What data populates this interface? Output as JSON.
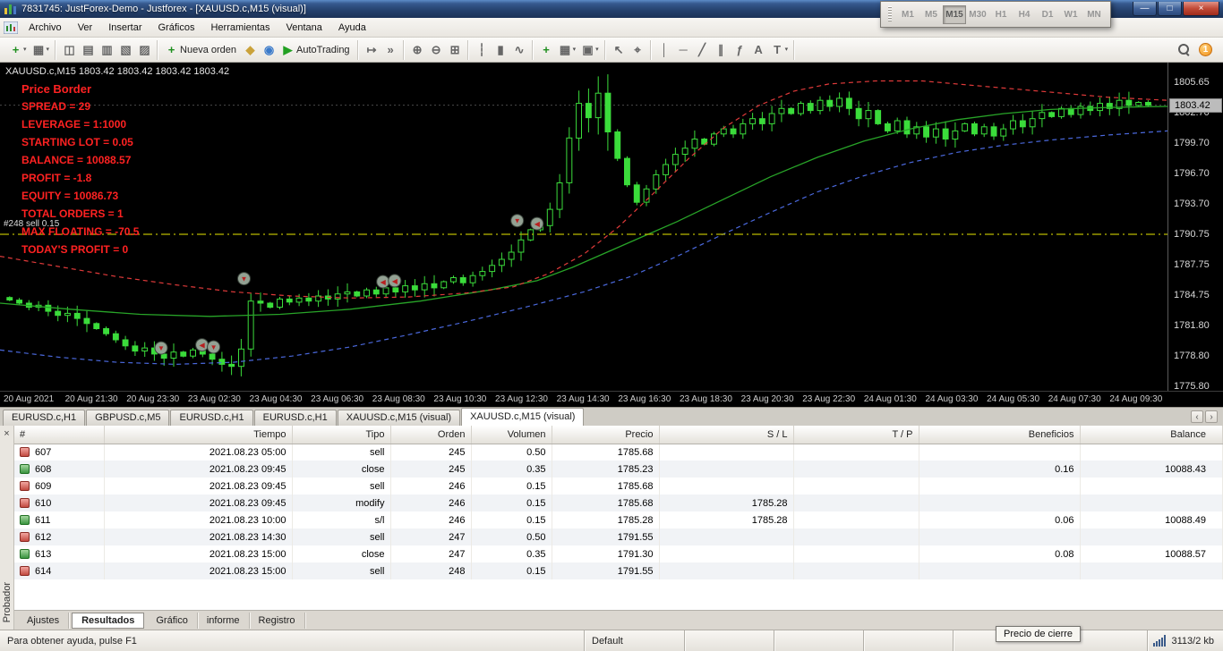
{
  "window": {
    "title": "7831745: JustForex-Demo - Justforex - [XAUUSD.c,M15 (visual)]",
    "buttons": {
      "minimize": "—",
      "restore": "□",
      "close": "×"
    }
  },
  "menu": {
    "items": [
      "Archivo",
      "Ver",
      "Insertar",
      "Gráficos",
      "Herramientas",
      "Ventana",
      "Ayuda"
    ]
  },
  "toolbar": {
    "groups": [
      {
        "items": [
          {
            "name": "new-chart",
            "glyph": "+",
            "color": "#1f8f1f",
            "dropdown": true
          },
          {
            "name": "profiles",
            "glyph": "▦",
            "color": "#666666",
            "dropdown": true
          }
        ]
      },
      {
        "items": [
          {
            "name": "market-watch",
            "glyph": "◫",
            "color": "#666666"
          },
          {
            "name": "data-window",
            "glyph": "▤",
            "color": "#666666"
          },
          {
            "name": "navigator",
            "glyph": "▥",
            "color": "#666666"
          },
          {
            "name": "terminal",
            "glyph": "▧",
            "color": "#666666"
          },
          {
            "name": "strategy-tester",
            "glyph": "▨",
            "color": "#666666"
          }
        ]
      },
      {
        "items": [
          {
            "name": "new-order",
            "glyph": "+",
            "color": "#1f8f1f",
            "label": "Nueva orden"
          },
          {
            "name": "metaeditor",
            "glyph": "◆",
            "color": "#caa23a"
          },
          {
            "name": "signals",
            "glyph": "◉",
            "color": "#3a7aca"
          },
          {
            "name": "autotrading",
            "glyph": "▶",
            "color": "#22a022",
            "label": "AutoTrading"
          }
        ]
      },
      {
        "items": [
          {
            "name": "chart-shift",
            "glyph": "↦",
            "color": "#666666"
          },
          {
            "name": "auto-scroll",
            "glyph": "»",
            "color": "#666666"
          }
        ]
      },
      {
        "items": [
          {
            "name": "zoom-in",
            "glyph": "⊕",
            "color": "#666666"
          },
          {
            "name": "zoom-out",
            "glyph": "⊖",
            "color": "#666666"
          },
          {
            "name": "tile-windows",
            "glyph": "⊞",
            "color": "#666666"
          }
        ]
      },
      {
        "items": [
          {
            "name": "bar-chart-mode",
            "glyph": "┆",
            "color": "#666666"
          },
          {
            "name": "candlestick-mode",
            "glyph": "▮",
            "color": "#666666"
          },
          {
            "name": "line-chart-mode",
            "glyph": "∿",
            "color": "#666666"
          }
        ]
      },
      {
        "items": [
          {
            "name": "indicators",
            "glyph": "+",
            "color": "#1f8f1f"
          },
          {
            "name": "periods",
            "glyph": "▦",
            "color": "#666666",
            "dropdown": true
          },
          {
            "name": "templates",
            "glyph": "▣",
            "color": "#666666",
            "dropdown": true
          }
        ]
      },
      {
        "items": [
          {
            "name": "cursor",
            "glyph": "↖",
            "color": "#666666"
          },
          {
            "name": "crosshair",
            "glyph": "⌖",
            "color": "#666666"
          }
        ]
      },
      {
        "items": [
          {
            "name": "vertical-line",
            "glyph": "│",
            "color": "#666666"
          },
          {
            "name": "horizontal-line",
            "glyph": "─",
            "color": "#666666"
          },
          {
            "name": "trendline",
            "glyph": "╱",
            "color": "#666666"
          },
          {
            "name": "channel",
            "glyph": "∥",
            "color": "#666666"
          },
          {
            "name": "fibonacci",
            "glyph": "ƒ",
            "color": "#666666"
          },
          {
            "name": "text-tool",
            "glyph": "A",
            "color": "#666666"
          },
          {
            "name": "arrow-tools",
            "glyph": "T",
            "color": "#666666",
            "dropdown": true
          }
        ]
      }
    ],
    "notification_count": "1"
  },
  "timeframes": {
    "buttons": [
      "M1",
      "M5",
      "M15",
      "M30",
      "H1",
      "H4",
      "D1",
      "W1",
      "MN"
    ],
    "active": "M15"
  },
  "chart": {
    "symbol_info": "XAUUSD.c,M15  1803.42 1803.42 1803.42 1803.42",
    "ea_lines": [
      "Price Border",
      "SPREAD = 29",
      "LEVERAGE = 1:1000",
      "STARTING LOT = 0.05",
      "BALANCE = 10088.57",
      "PROFIT = -1.8",
      "EQUITY =  10086.73",
      "TOTAL ORDERS = 1",
      "MAX FLOATING = -70.5",
      "TODAY'S PROFIT = 0"
    ],
    "position_label": "#248 sell 0.15",
    "current_price_label": "1803.42",
    "time_labels": [
      "20 Aug 2021",
      "20 Aug 21:30",
      "20 Aug 23:30",
      "23 Aug 02:30",
      "23 Aug 04:30",
      "23 Aug 06:30",
      "23 Aug 08:30",
      "23 Aug 10:30",
      "23 Aug 12:30",
      "23 Aug 14:30",
      "23 Aug 16:30",
      "23 Aug 18:30",
      "23 Aug 20:30",
      "23 Aug 22:30",
      "24 Aug 01:30",
      "24 Aug 03:30",
      "24 Aug 05:30",
      "24 Aug 07:30",
      "24 Aug 09:30"
    ]
  },
  "chart_data": {
    "type": "candlestick",
    "symbol": "XAUUSD.c",
    "timeframe": "M15",
    "price_top": 1807.6,
    "price_bottom": 1775.4,
    "current_price": 1803.42,
    "position_line": 1790.75,
    "price_ticks": [
      1805.65,
      1802.7,
      1799.7,
      1796.7,
      1793.7,
      1790.75,
      1787.75,
      1784.75,
      1781.8,
      1778.8,
      1775.8
    ],
    "closes": [
      1784.3,
      1784.0,
      1783.6,
      1783.8,
      1783.2,
      1782.8,
      1783.0,
      1782.5,
      1782.0,
      1781.5,
      1781.0,
      1780.4,
      1779.8,
      1779.3,
      1779.6,
      1779.0,
      1778.6,
      1779.2,
      1778.8,
      1779.4,
      1779.0,
      1778.5,
      1778.0,
      1777.8,
      1779.5,
      1784.2,
      1784.0,
      1783.6,
      1784.4,
      1784.1,
      1784.5,
      1784.2,
      1784.7,
      1784.4,
      1784.9,
      1785.1,
      1784.7,
      1785.3,
      1784.9,
      1785.5,
      1785.1,
      1785.7,
      1785.3,
      1785.9,
      1785.5,
      1786.1,
      1786.5,
      1786.0,
      1786.7,
      1787.1,
      1787.7,
      1788.3,
      1789.0,
      1790.2,
      1791.2,
      1791.6,
      1793.2,
      1795.8,
      1800.2,
      1803.6,
      1802.2,
      1804.6,
      1800.8,
      1798.2,
      1795.6,
      1793.9,
      1795.2,
      1796.6,
      1797.6,
      1798.6,
      1799.2,
      1800.1,
      1799.6,
      1800.6,
      1801.1,
      1800.6,
      1801.6,
      1802.1,
      1801.6,
      1802.6,
      1803.1,
      1802.6,
      1803.6,
      1802.9,
      1803.9,
      1803.3,
      1804.1,
      1803.1,
      1802.1,
      1802.9,
      1801.6,
      1800.9,
      1801.9,
      1800.6,
      1801.3,
      1800.3,
      1801.1,
      1800.1,
      1800.9,
      1801.6,
      1800.6,
      1801.3,
      1800.4,
      1801.1,
      1801.9,
      1801.3,
      1802.1,
      1802.7,
      1802.3,
      1803.1,
      1802.5,
      1803.3,
      1802.9,
      1803.6,
      1803.1,
      1803.9,
      1803.4,
      1803.7,
      1803.42
    ],
    "ma_green": [
      [
        0,
        1784.0
      ],
      [
        6,
        1783.4
      ],
      [
        12,
        1782.9
      ],
      [
        18,
        1782.7
      ],
      [
        24,
        1782.9
      ],
      [
        30,
        1783.4
      ],
      [
        36,
        1784.2
      ],
      [
        42,
        1785.3
      ],
      [
        46,
        1786.2
      ],
      [
        49,
        1787.5
      ],
      [
        52,
        1789.0
      ],
      [
        55,
        1790.5
      ],
      [
        58,
        1792.0
      ],
      [
        62,
        1794.2
      ],
      [
        66,
        1796.4
      ],
      [
        70,
        1798.3
      ],
      [
        74,
        1799.9
      ],
      [
        78,
        1801.1
      ],
      [
        82,
        1802.0
      ],
      [
        86,
        1802.6
      ],
      [
        90,
        1803.0
      ],
      [
        95,
        1803.2
      ],
      [
        100,
        1803.3
      ]
    ],
    "ma_red": [
      [
        0,
        1788.6
      ],
      [
        5,
        1787.6
      ],
      [
        10,
        1786.6
      ],
      [
        15,
        1785.8
      ],
      [
        20,
        1785.1
      ],
      [
        25,
        1784.7
      ],
      [
        30,
        1784.5
      ],
      [
        35,
        1784.6
      ],
      [
        40,
        1785.0
      ],
      [
        44,
        1785.6
      ],
      [
        47,
        1786.9
      ],
      [
        50,
        1788.8
      ],
      [
        53,
        1791.5
      ],
      [
        56,
        1794.8
      ],
      [
        59,
        1798.2
      ],
      [
        62,
        1801.2
      ],
      [
        65,
        1803.4
      ],
      [
        68,
        1804.8
      ],
      [
        71,
        1805.5
      ],
      [
        75,
        1805.8
      ],
      [
        79,
        1805.8
      ],
      [
        83,
        1805.4
      ],
      [
        87,
        1805.0
      ],
      [
        91,
        1804.6
      ],
      [
        95,
        1804.2
      ],
      [
        100,
        1803.9
      ]
    ],
    "ma_blue": [
      [
        0,
        1779.4
      ],
      [
        5,
        1778.7
      ],
      [
        10,
        1778.2
      ],
      [
        15,
        1778.0
      ],
      [
        20,
        1778.2
      ],
      [
        25,
        1778.8
      ],
      [
        30,
        1779.7
      ],
      [
        35,
        1780.9
      ],
      [
        40,
        1782.2
      ],
      [
        45,
        1783.6
      ],
      [
        50,
        1785.1
      ],
      [
        54,
        1786.6
      ],
      [
        58,
        1788.6
      ],
      [
        62,
        1790.8
      ],
      [
        66,
        1792.9
      ],
      [
        70,
        1794.9
      ],
      [
        74,
        1796.5
      ],
      [
        78,
        1797.8
      ],
      [
        82,
        1798.8
      ],
      [
        86,
        1799.5
      ],
      [
        90,
        1800.0
      ],
      [
        95,
        1800.5
      ],
      [
        100,
        1800.9
      ]
    ],
    "markers": [
      {
        "x": 13.8,
        "price": 1779.6,
        "glyph": "▼",
        "color": "#b82020"
      },
      {
        "x": 17.3,
        "price": 1779.9,
        "glyph": "◀",
        "color": "#b82020"
      },
      {
        "x": 18.3,
        "price": 1779.7,
        "glyph": "▼",
        "color": "#b82020"
      },
      {
        "x": 20.9,
        "price": 1786.4,
        "glyph": "▼",
        "color": "#b82020"
      },
      {
        "x": 32.8,
        "price": 1786.1,
        "glyph": "◀",
        "color": "#b82020"
      },
      {
        "x": 33.8,
        "price": 1786.2,
        "glyph": "◀",
        "color": "#b82020"
      },
      {
        "x": 44.3,
        "price": 1792.1,
        "glyph": "▼",
        "color": "#b82020"
      },
      {
        "x": 46.0,
        "price": 1791.8,
        "glyph": "◀",
        "color": "#b82020"
      }
    ],
    "colors": {
      "candle": "#3bdc3b",
      "ma_green": "#28a428",
      "ma_red": "#e03a3a",
      "ma_blue": "#4a68dc",
      "position_line": "#b9b900",
      "current_price_line": "#4a4a4a",
      "background": "#000000"
    }
  },
  "chart_tabs": {
    "tabs": [
      "EURUSD.c,H1",
      "GBPUSD.c,M5",
      "EURUSD.c,H1",
      "EURUSD.c,H1",
      "XAUUSD.c,M15 (visual)",
      "XAUUSD.c,M15 (visual)"
    ],
    "active_index": 5,
    "scroll_left": "‹",
    "scroll_right": "›"
  },
  "results": {
    "columns": [
      "#",
      "Tiempo",
      "Tipo",
      "Orden",
      "Volumen",
      "Precio",
      "S / L",
      "T / P",
      "Beneficios",
      "Balance"
    ],
    "rows": [
      {
        "icon": "sell",
        "cells": [
          "607",
          "2021.08.23 05:00",
          "sell",
          "245",
          "0.50",
          "1785.68",
          "",
          "",
          "",
          ""
        ]
      },
      {
        "icon": "close",
        "cells": [
          "608",
          "2021.08.23 09:45",
          "close",
          "245",
          "0.35",
          "1785.23",
          "",
          "",
          "0.16",
          "10088.43"
        ]
      },
      {
        "icon": "sell",
        "cells": [
          "609",
          "2021.08.23 09:45",
          "sell",
          "246",
          "0.15",
          "1785.68",
          "",
          "",
          "",
          ""
        ]
      },
      {
        "icon": "modify",
        "cells": [
          "610",
          "2021.08.23 09:45",
          "modify",
          "246",
          "0.15",
          "1785.68",
          "1785.28",
          "",
          "",
          ""
        ]
      },
      {
        "icon": "close",
        "cells": [
          "611",
          "2021.08.23 10:00",
          "s/l",
          "246",
          "0.15",
          "1785.28",
          "1785.28",
          "",
          "0.06",
          "10088.49"
        ]
      },
      {
        "icon": "sell",
        "cells": [
          "612",
          "2021.08.23 14:30",
          "sell",
          "247",
          "0.50",
          "1791.55",
          "",
          "",
          "",
          ""
        ]
      },
      {
        "icon": "close",
        "cells": [
          "613",
          "2021.08.23 15:00",
          "close",
          "247",
          "0.35",
          "1791.30",
          "",
          "",
          "0.08",
          "10088.57"
        ]
      },
      {
        "icon": "sell",
        "cells": [
          "614",
          "2021.08.23 15:00",
          "sell",
          "248",
          "0.15",
          "1791.55",
          "",
          "",
          "",
          ""
        ]
      }
    ]
  },
  "bottom_tabs": {
    "tabs": [
      "Ajustes",
      "Resultados",
      "Gráfico",
      "informe",
      "Registro"
    ],
    "active": "Resultados"
  },
  "tester_panel": {
    "label": "Probador",
    "close": "×"
  },
  "statusbar": {
    "help": "Para obtener ayuda, pulse F1",
    "profile": "Default",
    "tooltip": "Precio de cierre",
    "connection": "3113/2 kb"
  }
}
